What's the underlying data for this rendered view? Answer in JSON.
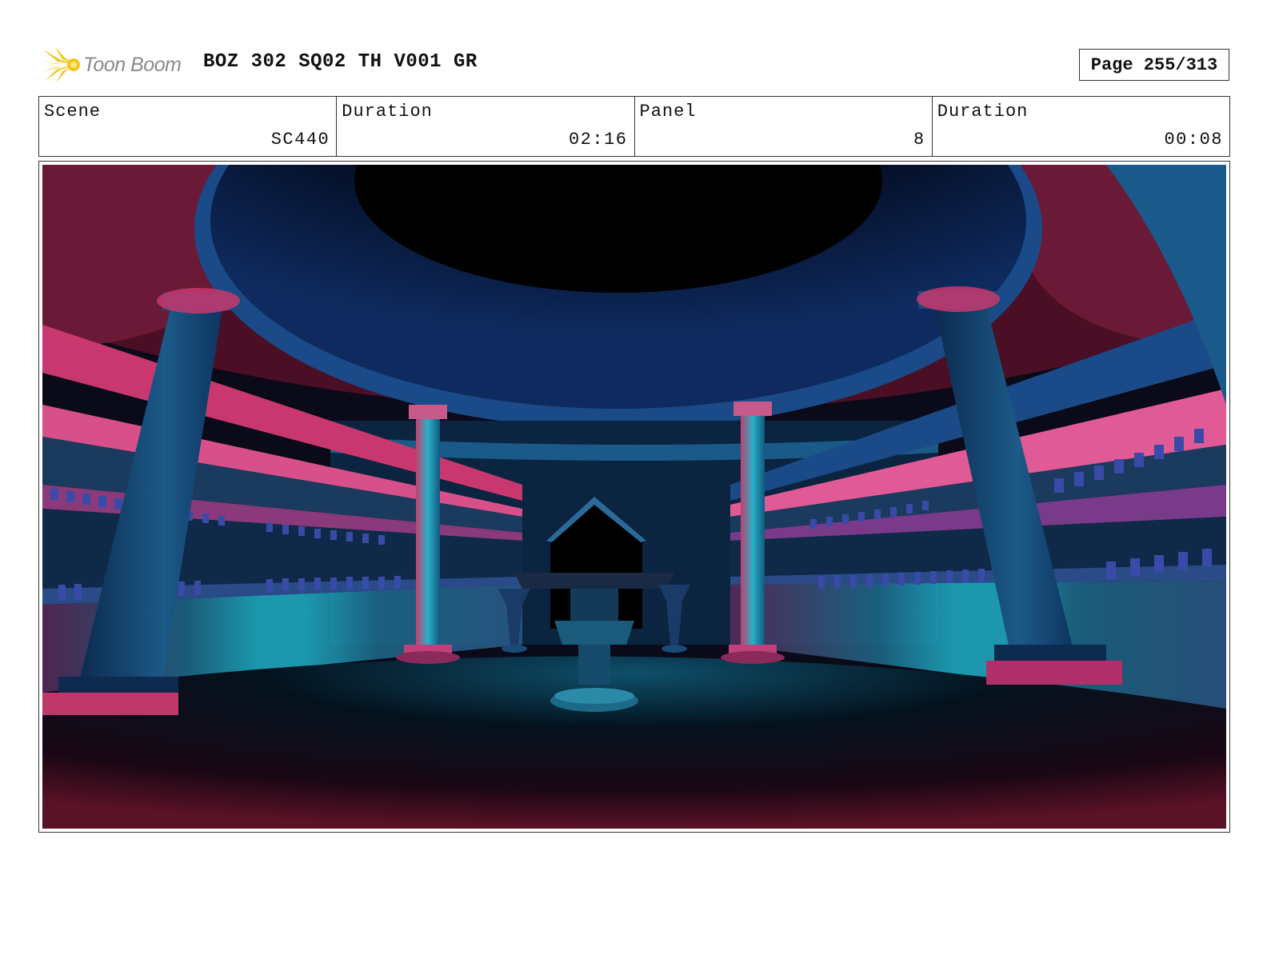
{
  "header": {
    "logo_text": "Toon Boom",
    "title": "BOZ 302 SQ02 TH V001 GR",
    "page": "Page 255/313"
  },
  "info": {
    "scene_label": "Scene",
    "scene_value": "SC440",
    "scene_duration_label": "Duration",
    "scene_duration_value": "02:16",
    "panel_label": "Panel",
    "panel_value": "8",
    "panel_duration_label": "Duration",
    "panel_duration_value": "00:08"
  },
  "colors": {
    "logo_star": "#f5c518",
    "logo_text": "#8a8a8a",
    "scene_magenta": "#c8386e",
    "scene_cyan": "#1fa8c8",
    "scene_navy": "#0a1a3a"
  },
  "icons": {
    "logo": "starburst-icon"
  }
}
